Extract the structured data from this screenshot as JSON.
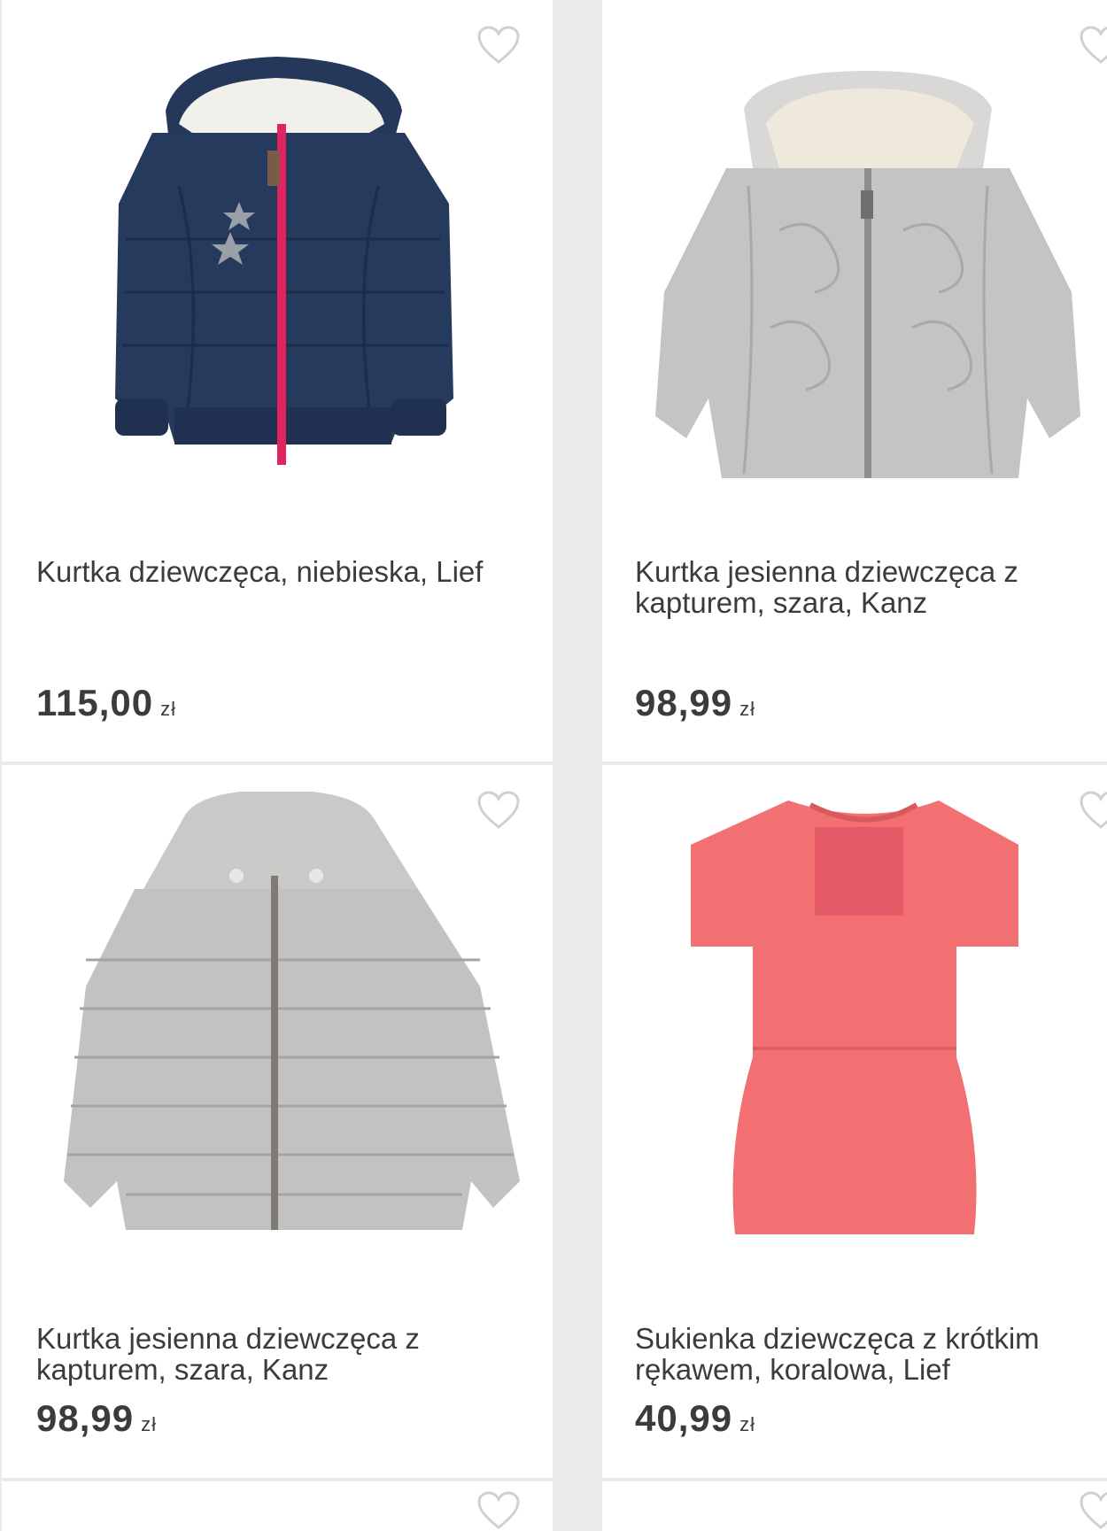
{
  "products": [
    {
      "title": "Kurtka dziewczęca, niebieska, Lief",
      "price": "115,00",
      "currency": "zł",
      "image": "navy-puffer-jacket",
      "color": "#263a5e"
    },
    {
      "title": "Kurtka jesienna dziewczęca z kapturem, szara, Kanz",
      "price": "98,99",
      "currency": "zł",
      "image": "grey-quilted-jacket",
      "color": "#bcbcbc"
    },
    {
      "title": "Kurtka jesienna dziewczęca z kapturem, szara, Kanz",
      "price": "98,99",
      "currency": "zł",
      "image": "grey-puffer-jacket",
      "color": "#c2c2c0"
    },
    {
      "title": "Sukienka dziewczęca z krótkim rękawem, koralowa, Lief",
      "price": "40,99",
      "currency": "zł",
      "image": "coral-dress",
      "color": "#f26f72"
    }
  ],
  "wishlist_icon": "heart-outline-icon"
}
